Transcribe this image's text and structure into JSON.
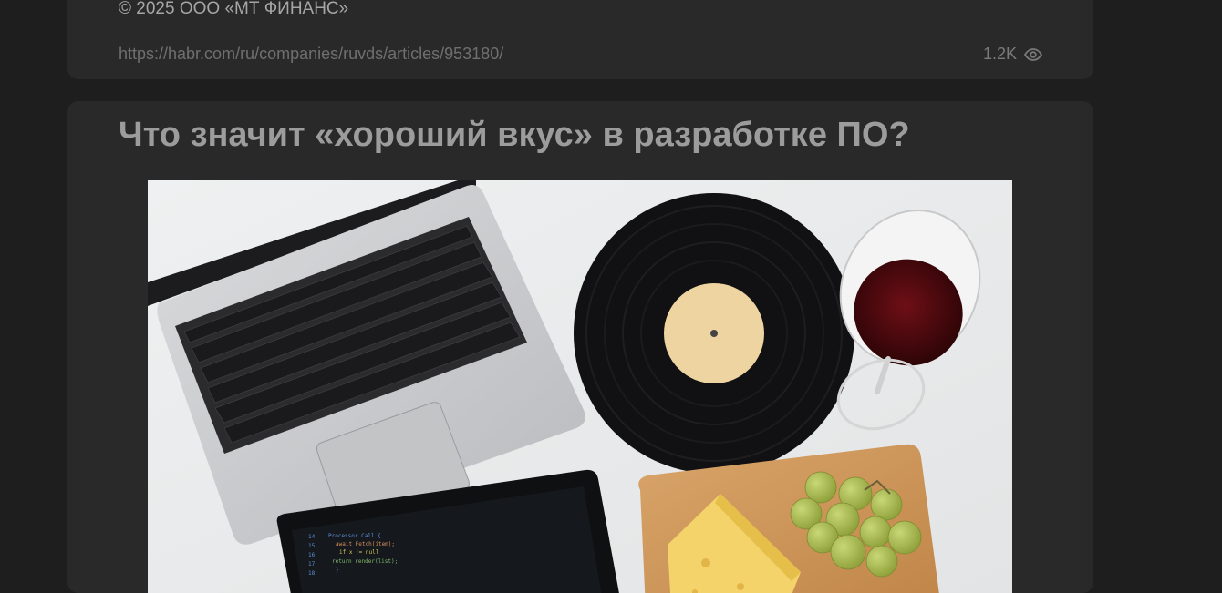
{
  "previous_post": {
    "copyright": "© 2025 ООО «МТ ФИНАНС»",
    "url": "https://habr.com/ru/companies/ruvds/articles/953180/",
    "views": "1.2K",
    "views_icon": "eye-icon"
  },
  "post": {
    "title": "Что значит «хороший вкус» в разработке ПО?",
    "cover_image": "laptop-vinyl-wine-cheese-photo"
  },
  "colors": {
    "page_bg": "#1e1e1e",
    "card_bg": "#292929",
    "title": "#9c9c9c",
    "muted": "#6f6f6f"
  }
}
